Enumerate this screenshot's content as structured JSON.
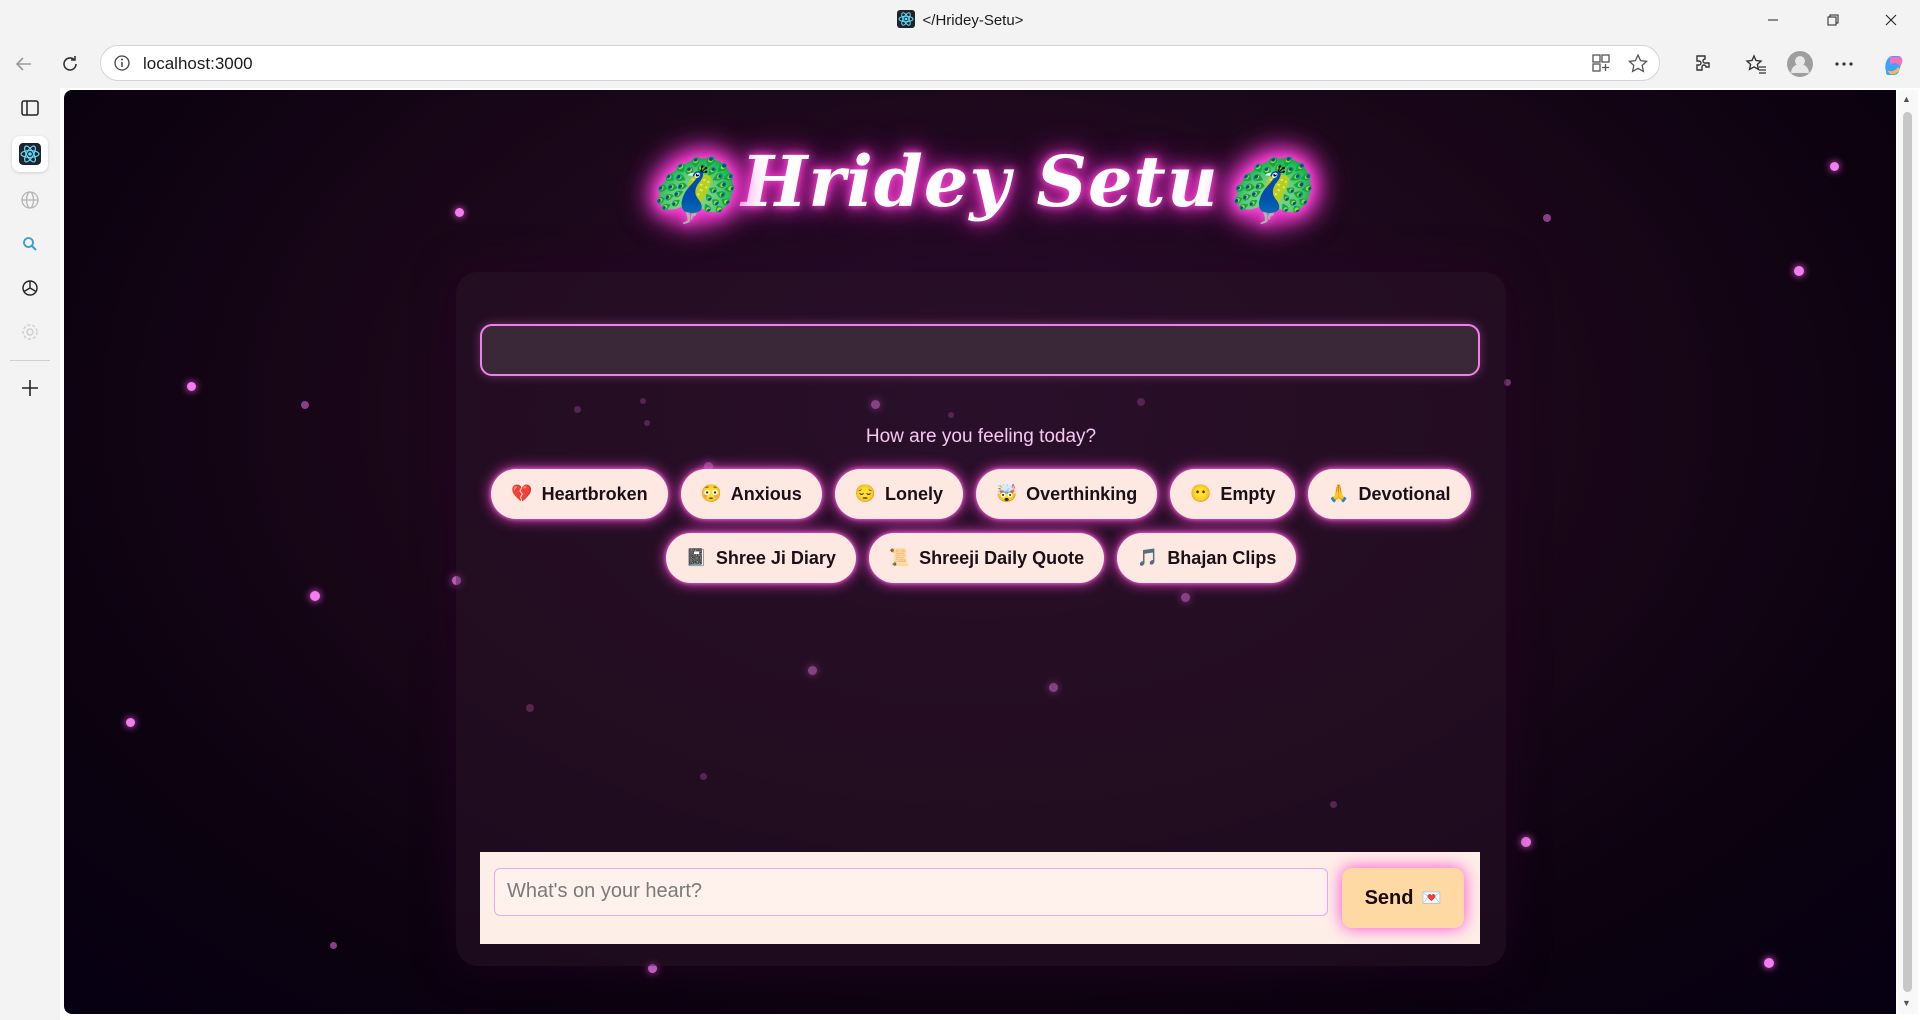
{
  "window": {
    "title": "</Hridey-Setu>",
    "favicon": "react-icon",
    "controls": [
      "minimize-icon",
      "restore-icon",
      "close-icon"
    ]
  },
  "browser": {
    "url": "localhost:3000",
    "nav": [
      "back-icon",
      "refresh-icon"
    ],
    "url_actions": [
      "app-available-icon",
      "favorite-star-icon"
    ],
    "toolbar": [
      "extensions-icon",
      "favorites-icon",
      "profile-icon",
      "more-icon",
      "copilot-icon"
    ]
  },
  "sidebar": {
    "items": [
      "tab-actions-icon",
      "react-tab-icon",
      "globe-icon",
      "search-icon",
      "openai-icon",
      "settings-icon",
      "add-icon"
    ]
  },
  "app": {
    "title": "Hridey Setu",
    "peacock": "🦚",
    "feeling_prompt": "How are you feeling today?",
    "moods_row1": [
      {
        "emoji": "💔",
        "label": "Heartbroken"
      },
      {
        "emoji": "😳",
        "label": "Anxious"
      },
      {
        "emoji": "😔",
        "label": "Lonely"
      },
      {
        "emoji": "🤯",
        "label": "Overthinking"
      },
      {
        "emoji": "😶",
        "label": "Empty"
      },
      {
        "emoji": "🙏",
        "label": "Devotional"
      }
    ],
    "moods_row2": [
      {
        "emoji": "📓",
        "label": "Shree Ji Diary"
      },
      {
        "emoji": "📜",
        "label": "Shreeji Daily Quote"
      },
      {
        "emoji": "🎵",
        "label": "Bhajan Clips"
      }
    ],
    "message_placeholder": "What's on your heart?",
    "send_label": "Send",
    "send_emoji": "💌"
  },
  "colors": {
    "accent": "#f27fe9",
    "chip_bg": "#fde9e2",
    "send_bg": "#ffd9a3",
    "glow": "#ff44d6"
  }
}
